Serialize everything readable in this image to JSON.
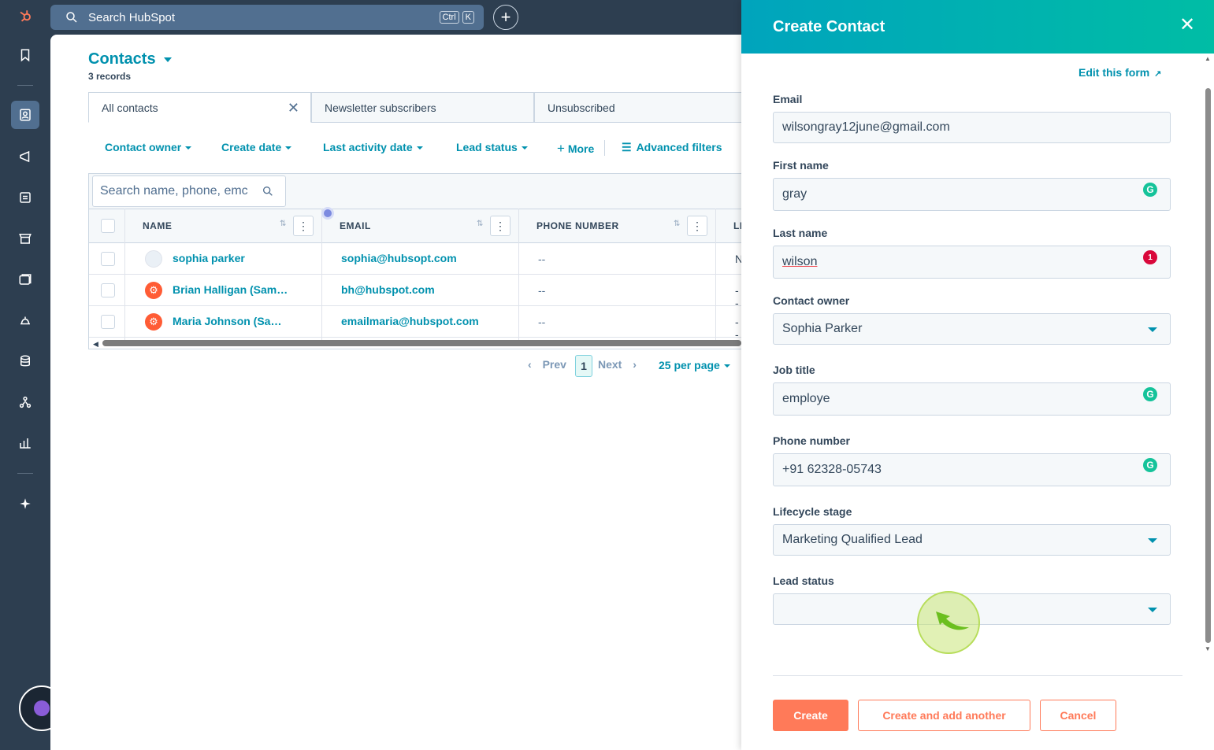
{
  "topbar": {
    "search_placeholder": "Search HubSpot",
    "kbd_ctrl": "Ctrl",
    "kbd_k": "K",
    "plus": "+"
  },
  "nav_icons": [
    "hubspot-logo-icon",
    "bookmark-icon",
    "contacts-icon",
    "marketing-icon",
    "content-icon",
    "commerce-icon",
    "sales-icon",
    "service-icon",
    "data-icon",
    "automation-icon",
    "reporting-icon",
    "ai-sparkle-icon"
  ],
  "page": {
    "title": "Contacts",
    "records": "3 records",
    "tabs": [
      "All contacts",
      "Newsletter subscribers",
      "Unsubscribed"
    ],
    "filters": [
      "Contact owner",
      "Create date",
      "Last activity date",
      "Lead status"
    ],
    "more": "More",
    "advanced_filters": "Advanced filters",
    "table_search_placeholder": "Search name, phone, emc",
    "columns": [
      "NAME",
      "EMAIL",
      "PHONE NUMBER",
      "LI"
    ],
    "rows": [
      {
        "name": "sophia parker",
        "email": "sophia@hubsopt.com",
        "phone": "--",
        "lead": "N"
      },
      {
        "name": "Brian Halligan (Sam…",
        "email": "bh@hubspot.com",
        "phone": "--",
        "lead": "--"
      },
      {
        "name": "Maria Johnson (Sa…",
        "email": "emailmaria@hubspot.com",
        "phone": "--",
        "lead": "--"
      }
    ],
    "pagination": {
      "prev": "Prev",
      "page": "1",
      "next": "Next",
      "per_page": "25 per page"
    }
  },
  "panel": {
    "title": "Create Contact",
    "edit_form": "Edit this form",
    "fields": {
      "email": {
        "label": "Email",
        "value": "wilsongray12june@gmail.com"
      },
      "first_name": {
        "label": "First name",
        "value": "gray"
      },
      "last_name": {
        "label": "Last name",
        "value": "wilson",
        "badge": "1"
      },
      "owner": {
        "label": "Contact owner",
        "value": "Sophia Parker"
      },
      "job_title": {
        "label": "Job title",
        "value": "employe"
      },
      "phone": {
        "label": "Phone number",
        "value": "+91 62328-05743"
      },
      "lifecycle": {
        "label": "Lifecycle stage",
        "value": "Marketing Qualified Lead"
      },
      "lead_status": {
        "label": "Lead status",
        "value": ""
      }
    },
    "buttons": {
      "create": "Create",
      "create_another": "Create and add another",
      "cancel": "Cancel"
    }
  },
  "colors": {
    "accent": "#0091ae",
    "primary_button": "#ff7a59",
    "nav_bg": "#2d3e50"
  }
}
